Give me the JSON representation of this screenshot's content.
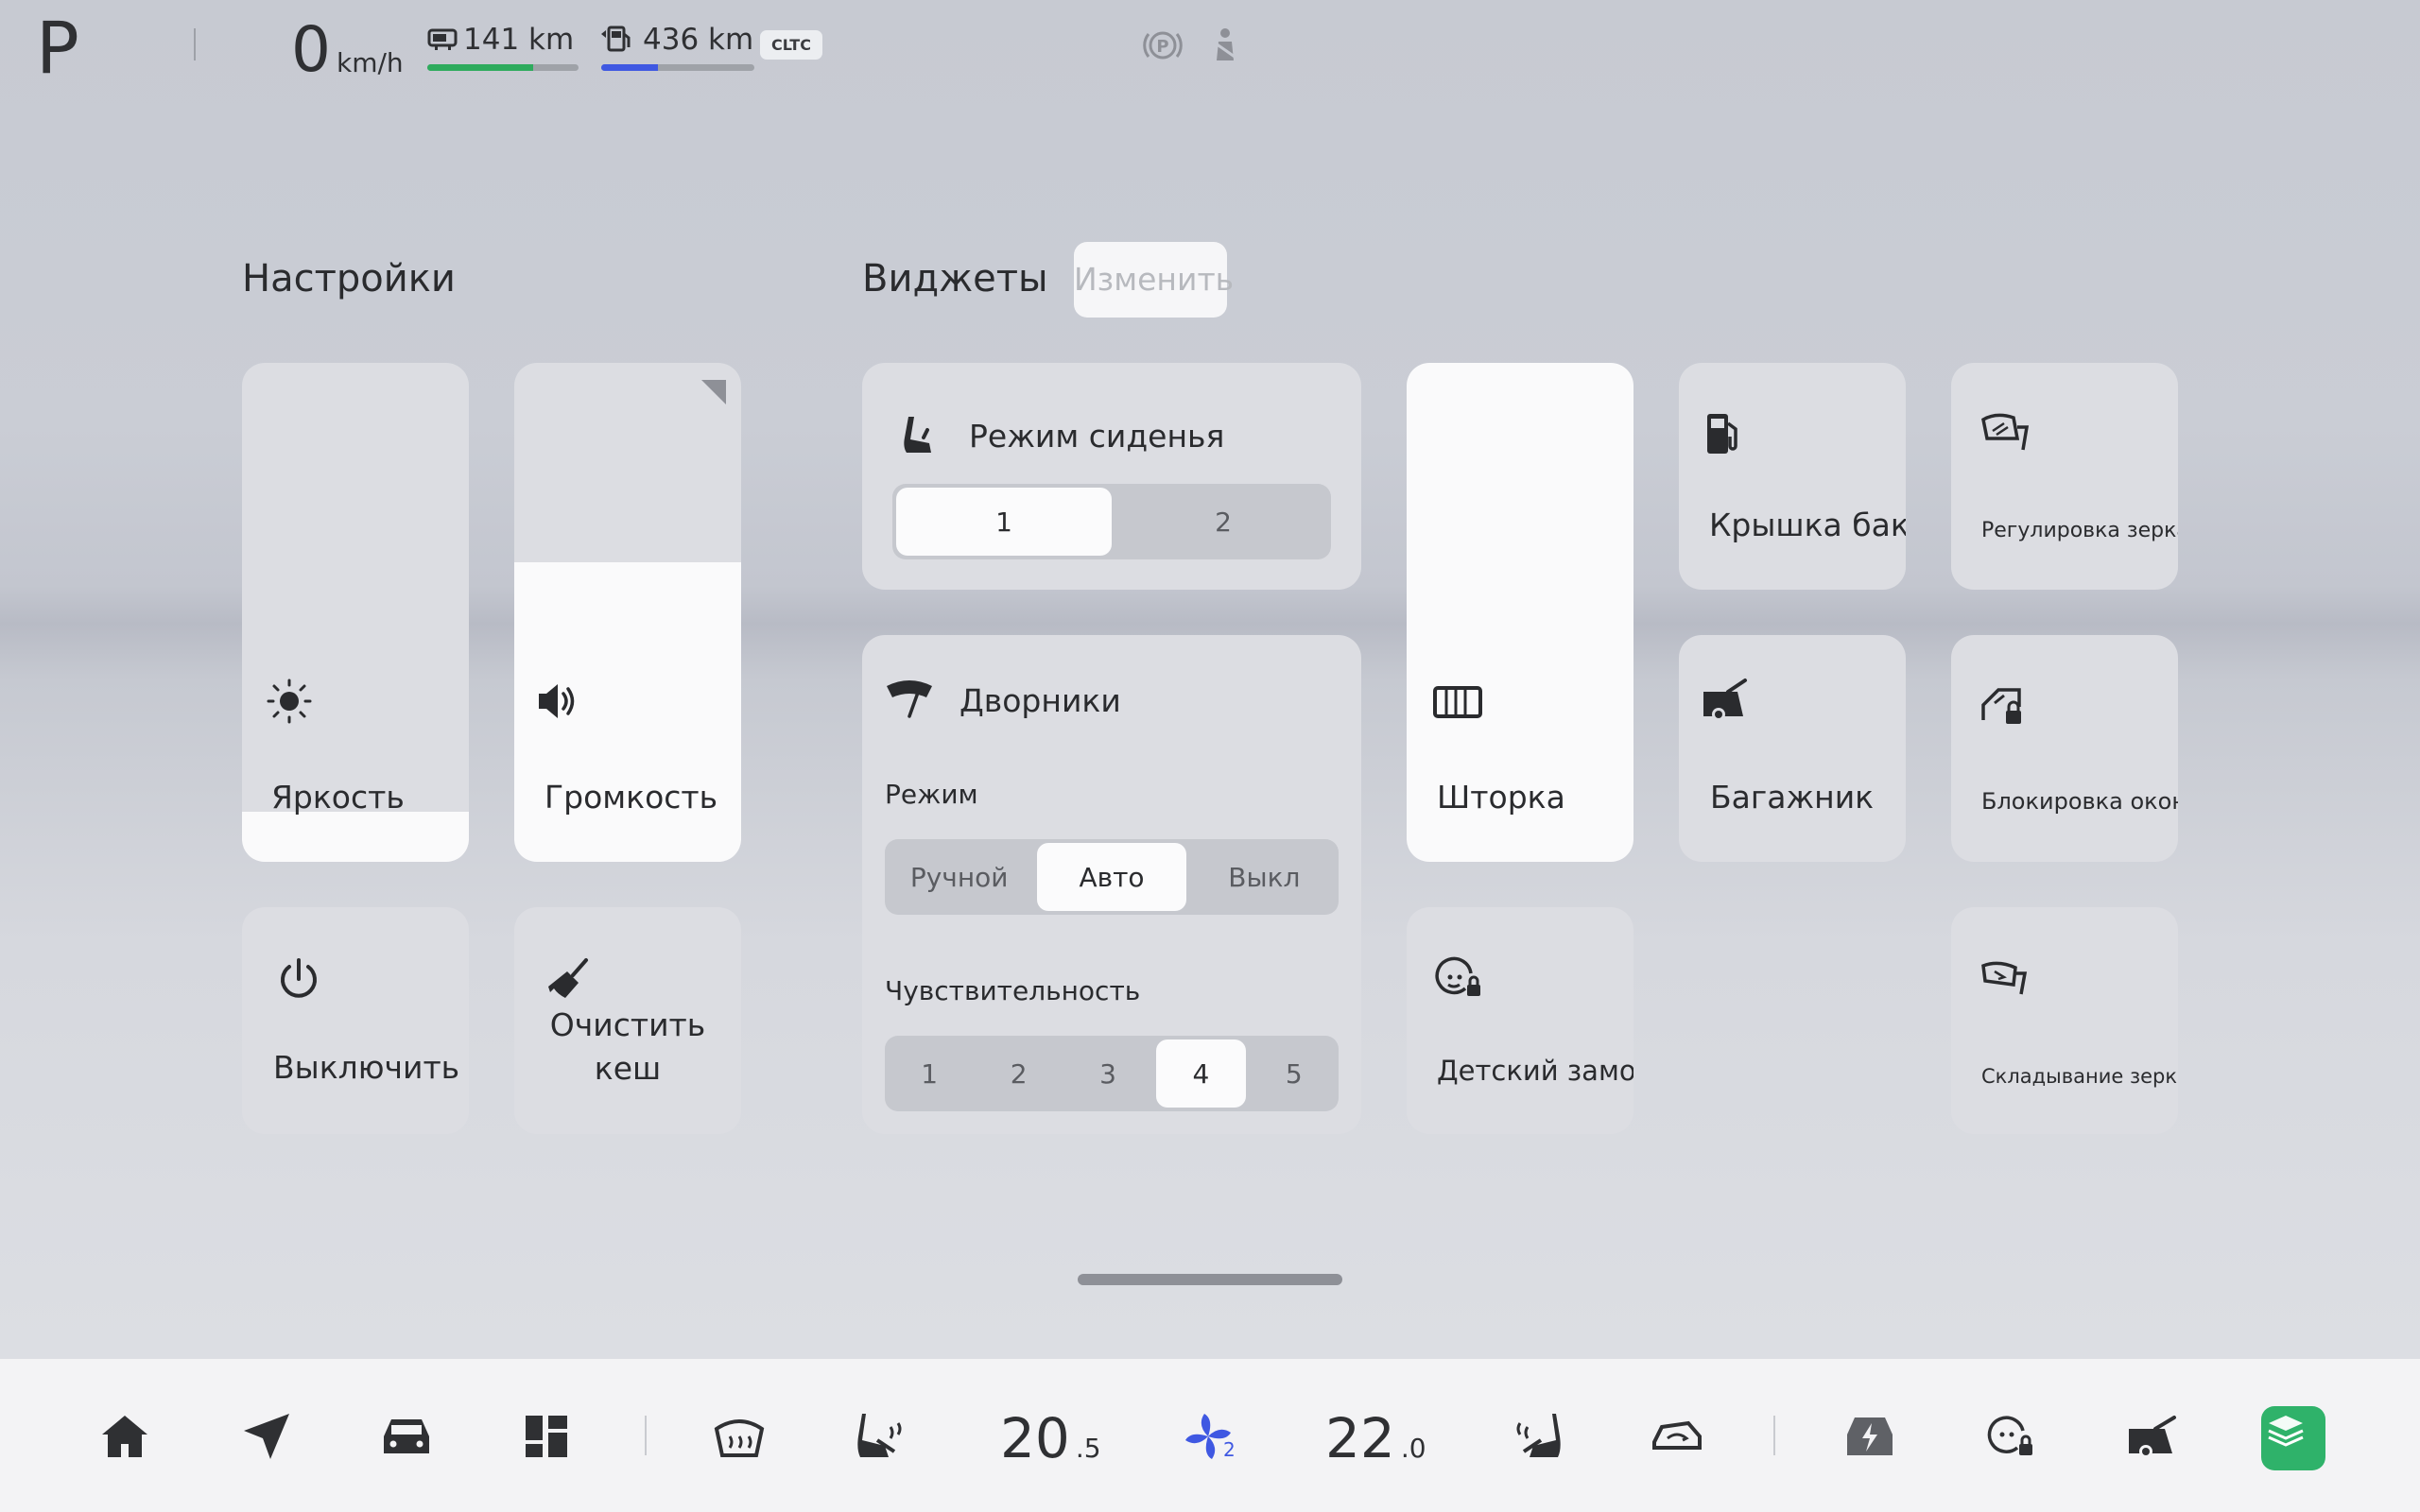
{
  "status": {
    "gear": "P",
    "speed": "0",
    "speed_unit": "km/h",
    "range_electric": "141 km",
    "range_electric_level": 0.7,
    "range_fuel": "436 km",
    "range_fuel_level": 0.37,
    "cycle_badge": "CLTC",
    "colors": {
      "electric": "#2eab5d",
      "fuel": "#3f58e2"
    }
  },
  "settings": {
    "title": "Настройки",
    "brightness": {
      "label": "Яркость",
      "level": 0.1
    },
    "volume": {
      "label": "Громкость",
      "level": 0.6
    },
    "power_off": {
      "label": "Выключить"
    },
    "clear_cache": {
      "label_line1": "Очистить",
      "label_line2": "кеш"
    }
  },
  "widgets": {
    "title": "Виджеты",
    "edit_label": "Изменить",
    "seat_mode": {
      "label": "Режим сиденья",
      "options": [
        "1",
        "2"
      ],
      "selected": "1"
    },
    "wipers": {
      "label": "Дворники",
      "mode_label": "Режим",
      "modes": [
        "Ручной",
        "Авто",
        "Выкл"
      ],
      "selected_mode": "Авто",
      "sensitivity_label": "Чувствительность",
      "sensitivity": [
        "1",
        "2",
        "3",
        "4",
        "5"
      ],
      "selected_sensitivity": "4"
    },
    "blind": {
      "label": "Шторка"
    },
    "fuel_cap": {
      "label": "Крышка бака"
    },
    "mirror_adjust": {
      "label": "Регулировка зеркал"
    },
    "trunk": {
      "label": "Багажник"
    },
    "window_lock": {
      "label": "Блокировка окон"
    },
    "child_lock": {
      "label": "Детский замок"
    },
    "mirror_fold": {
      "label": "Складывание зеркал"
    }
  },
  "dock": {
    "temp_left": "20",
    "temp_left_decimal": ".5",
    "fan_level": "2",
    "temp_right": "22",
    "temp_right_decimal": ".0",
    "accent_color": "#3f58e2"
  }
}
